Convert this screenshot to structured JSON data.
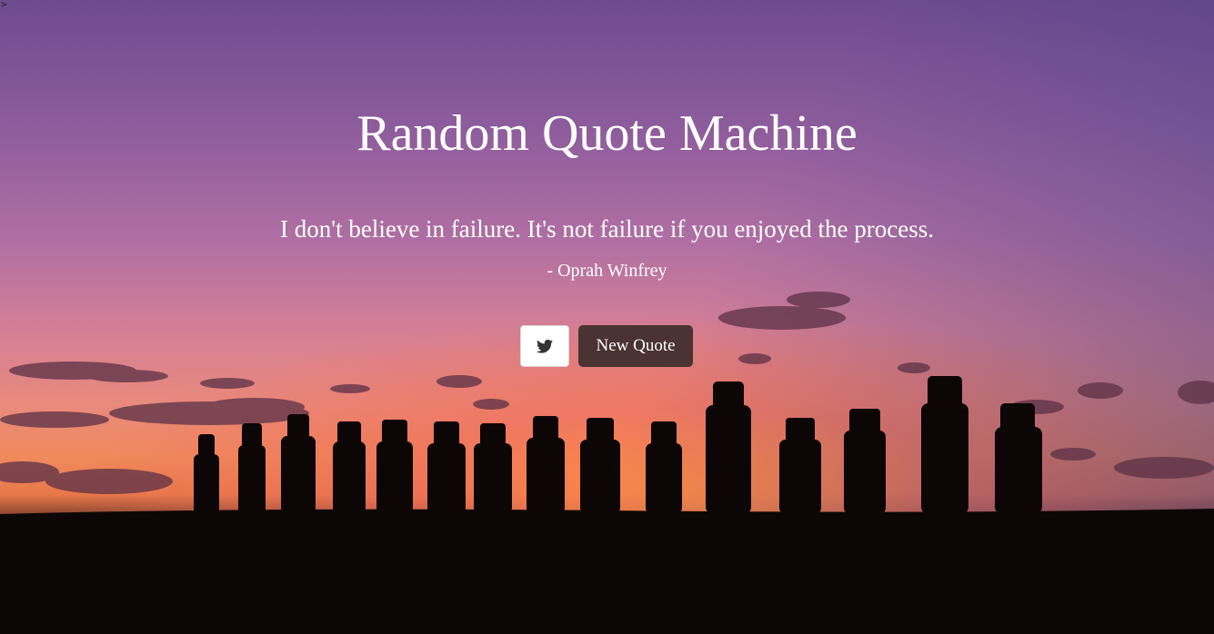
{
  "page": {
    "caret": ">",
    "title": "Random Quote Machine"
  },
  "quote": {
    "text": "I don't believe in failure. It's not failure if you enjoyed the process.",
    "author": "- Oprah Winfrey"
  },
  "actions": {
    "tweet_icon": "twitter-icon",
    "new_quote_label": "New Quote"
  },
  "colors": {
    "text": "#ffffff",
    "new_quote_bg": "#4a3332",
    "tweet_bg": "#ffffff",
    "tweet_icon": "#333333"
  }
}
